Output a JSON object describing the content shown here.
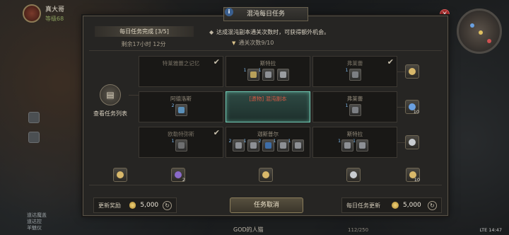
{
  "player": {
    "name": "真大哥",
    "level": "等级68"
  },
  "panel": {
    "title": "混沌每日任务",
    "daily_status": "每日任务完成 [3/5]",
    "time_left": "剩余17小时 12分",
    "description": "达成混沌副本通关次数时，可获得额外机会。",
    "progress": "通关次数9/10"
  },
  "view_list_label": "查看任务列表",
  "grid": {
    "rows": [
      [
        {
          "title": "特莱雅蕾之记忆",
          "state": "done",
          "items": []
        },
        {
          "title": "斯特拉",
          "state": "normal",
          "items": [
            {
              "count": "1",
              "color": "#b7a05a"
            },
            {
              "count": "1",
              "color": "#8d9095"
            },
            {
              "count": "",
              "color": "#9a9da1"
            }
          ]
        },
        {
          "title": "弗莱蕾",
          "state": "done",
          "items": [
            {
              "count": "1",
              "color": "#7c7f84"
            }
          ]
        }
      ],
      [
        {
          "title": "阿德洛斯",
          "state": "normal",
          "items": [
            {
              "count": "2",
              "color": "#5a8fb8"
            }
          ]
        },
        {
          "title": "[遗物] 混沌副本",
          "state": "active",
          "items": []
        },
        {
          "title": "弗莱蕾",
          "state": "normal",
          "items": [
            {
              "count": "1",
              "color": "#7c7f84"
            }
          ]
        }
      ],
      [
        {
          "title": "欧勒特弥斯",
          "state": "done",
          "items": [
            {
              "count": "1",
              "color": "#6e6f70"
            }
          ]
        },
        {
          "title": "迦斯普尔",
          "state": "normal",
          "items": [
            {
              "count": "2",
              "color": "#8d9095"
            },
            {
              "count": "1",
              "color": "#8d9095"
            },
            {
              "count": "2",
              "color": "#3e6ea8"
            },
            {
              "count": "1",
              "color": "#8d9095"
            },
            {
              "count": "1",
              "color": "#8d9095"
            }
          ]
        },
        {
          "title": "斯特拉",
          "state": "normal",
          "items": [
            {
              "count": "1",
              "color": "#8d9095"
            },
            {
              "count": "1",
              "color": "#8d9095"
            }
          ]
        }
      ]
    ]
  },
  "row_rewards": [
    {
      "count": "",
      "color": "#d8b86a"
    },
    {
      "count": "10",
      "color": "#6aa0e0"
    },
    {
      "count": "",
      "color": "#c8ccd0"
    }
  ],
  "column_rewards": [
    {
      "count": "",
      "color": "#d8b86a"
    },
    {
      "count": "2",
      "color": "#8a6ac8"
    },
    {
      "count": "",
      "color": "#d8b86a"
    },
    {
      "count": "",
      "color": "#c8ccd0"
    },
    {
      "count": "10",
      "color": "#d8b86a"
    }
  ],
  "refresh_reward": {
    "label": "更新奖励",
    "value": "5,000"
  },
  "cancel_button": "任务取消",
  "daily_refresh": {
    "label": "每日任务更新",
    "value": "5,000"
  },
  "bottom": {
    "status": "GOD的人猫",
    "page": "112/250",
    "sys": "LTE 14:47"
  },
  "side_texts": [
    "道达魔盖",
    "道达控",
    "羊魅仪"
  ],
  "colors": {
    "active_border": "#6fc9b3",
    "active_title": "#d75a45",
    "close": "#b02a2a"
  }
}
